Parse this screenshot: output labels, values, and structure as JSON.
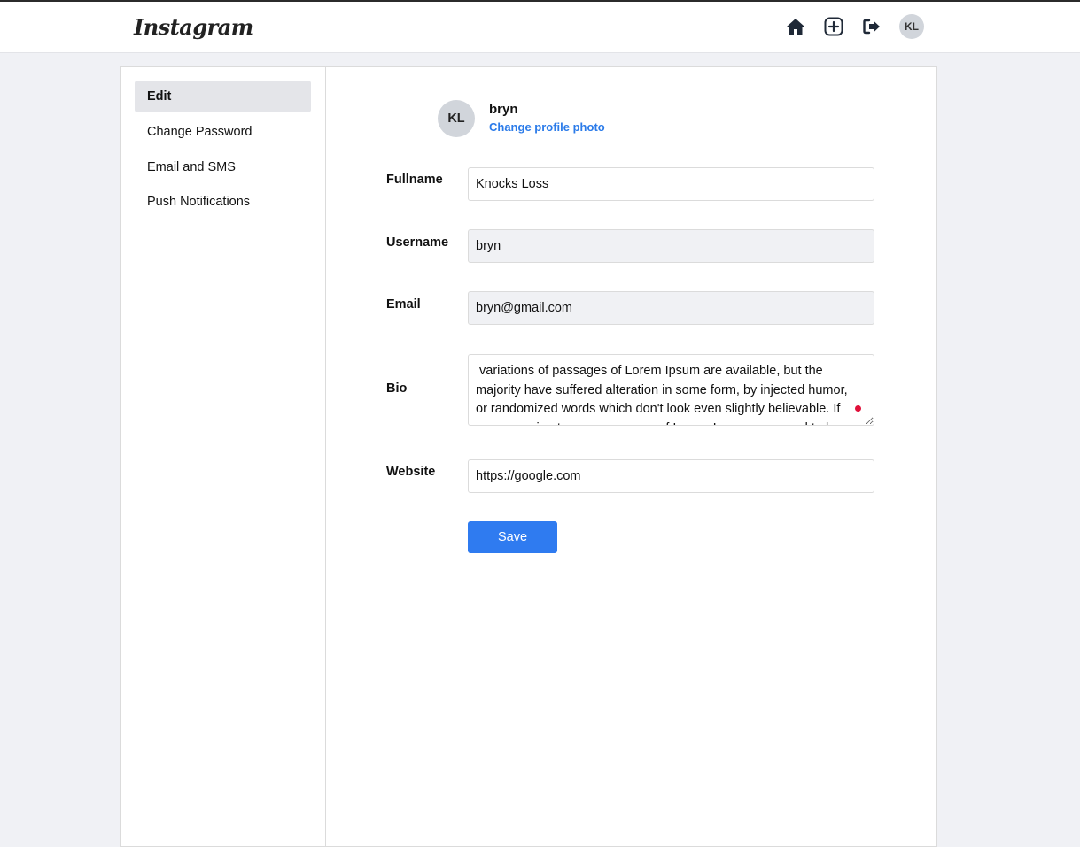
{
  "header": {
    "logo": "Instagram",
    "avatar_initials": "KL"
  },
  "sidebar": {
    "items": [
      {
        "label": "Edit"
      },
      {
        "label": "Change Password"
      },
      {
        "label": "Email and SMS"
      },
      {
        "label": "Push Notifications"
      }
    ]
  },
  "profile": {
    "avatar_initials": "KL",
    "username": "bryn",
    "change_photo_label": "Change profile photo"
  },
  "form": {
    "fullname_label": "Fullname",
    "fullname_value": "Knocks Loss",
    "username_label": "Username",
    "username_value": "bryn",
    "email_label": "Email",
    "email_value": "bryn@gmail.com",
    "bio_label": "Bio",
    "bio_value": " variations of passages of Lorem Ipsum are available, but the majority have suffered alteration in some form, by injected humor, or randomized words which don't look even slightly believable. If you are going to use a passage of Lorem Ipsum, you need to be",
    "website_label": "Website",
    "website_value": "https://google.com",
    "save_label": "Save"
  },
  "colors": {
    "accent": "#2f7bf0",
    "link": "#2b7be9",
    "page_bg": "#f0f1f5"
  }
}
